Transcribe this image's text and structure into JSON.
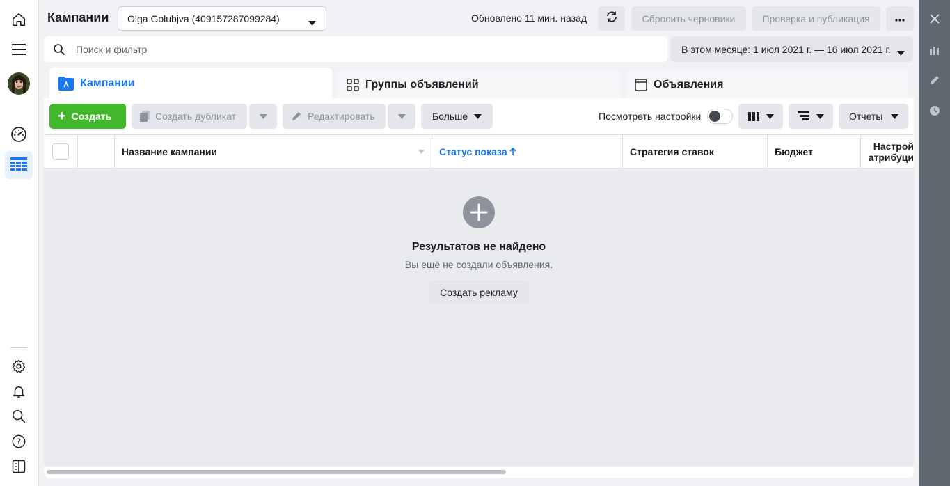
{
  "header": {
    "title": "Кампании",
    "account": "Olga Golubjva (409157287099284)",
    "updated": "Обновлено 11 мин. назад",
    "discard_label": "Сбросить черновики",
    "publish_label": "Проверка и публикация"
  },
  "search": {
    "placeholder": "Поиск и фильтр"
  },
  "date_range": "В этом месяце: 1 июл 2021 г. — 16 июл 2021 г.",
  "tabs": [
    {
      "label": "Кампании",
      "active": true
    },
    {
      "label": "Группы объявлений",
      "active": false
    },
    {
      "label": "Объявления",
      "active": false
    }
  ],
  "toolbar": {
    "create_label": "Создать",
    "duplicate_label": "Создать дубликат",
    "edit_label": "Редактировать",
    "more_label": "Больше",
    "view_settings_label": "Посмотреть настройки",
    "reports_label": "Отчеты"
  },
  "table": {
    "columns": [
      "Название кампании",
      "Статус показа",
      "Стратегия ставок",
      "Бюджет",
      "Настрой атрибуци"
    ],
    "sorted_column": "Статус показа"
  },
  "empty_state": {
    "title": "Результатов не найдено",
    "subtitle": "Вы ещё не создали объявления.",
    "button_label": "Создать рекламу"
  },
  "colors": {
    "accent": "#1877f2",
    "create_green": "#42b72a",
    "rail_gray": "#606770"
  },
  "icons": [
    "home-icon",
    "menu-icon",
    "dashboard-icon",
    "ads-table-icon",
    "settings-icon",
    "bell-icon",
    "search-icon",
    "help-icon",
    "panel-toggle-icon",
    "close-icon",
    "chart-icon",
    "pencil-icon",
    "clock-icon"
  ]
}
